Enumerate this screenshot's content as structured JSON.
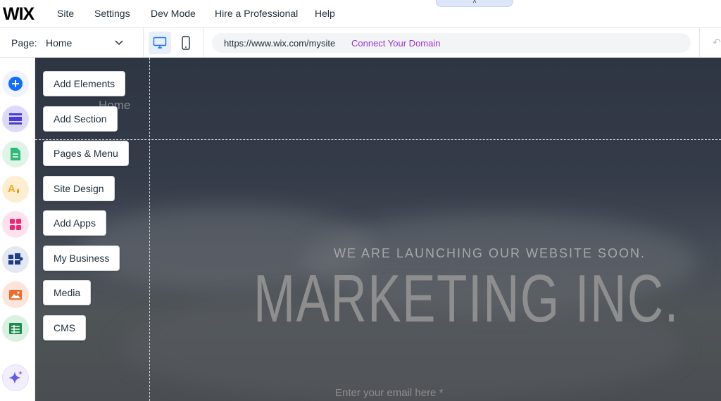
{
  "topbar": {
    "logo": "WIX",
    "menu": [
      "Site",
      "Settings",
      "Dev Mode",
      "Hire a Professional",
      "Help"
    ],
    "collapse_icon": "chevron-up-icon"
  },
  "pagebar": {
    "page_label": "Page:",
    "page_value": "Home",
    "url": "https://www.wix.com/mysite",
    "connect_domain": "Connect Your Domain",
    "desktop_active": true
  },
  "sidebar": {
    "items": [
      {
        "label": "Add Elements",
        "icon": "plus-circle-icon",
        "color": "#116dff",
        "bg": "#e7effd"
      },
      {
        "label": "Add Section",
        "icon": "section-icon",
        "color": "#5a48f5",
        "bg": "#e0dcfb"
      },
      {
        "label": "Pages & Menu",
        "icon": "page-icon",
        "color": "#2db976",
        "bg": "#e2f5ea"
      },
      {
        "label": "Site Design",
        "icon": "design-icon",
        "color": "#f5a623",
        "bg": "#fdf0d8"
      },
      {
        "label": "Add Apps",
        "icon": "apps-grid-icon",
        "color": "#f2247a",
        "bg": "#fde3ee"
      },
      {
        "label": "My Business",
        "icon": "business-icon",
        "color": "#1d3c8c",
        "bg": "#e1e6f2"
      },
      {
        "label": "Media",
        "icon": "image-icon",
        "color": "#f26b2a",
        "bg": "#fde6dc"
      },
      {
        "label": "CMS",
        "icon": "table-icon",
        "color": "#1e8a4c",
        "bg": "#dcf1e4"
      }
    ],
    "ai_icon": "sparkle-icon"
  },
  "canvas": {
    "ghost_label": "Home",
    "tagline": "WE ARE LAUNCHING OUR WEBSITE SOON.",
    "company": "MARKETING INC.",
    "email_placeholder": "Enter your email here *"
  }
}
